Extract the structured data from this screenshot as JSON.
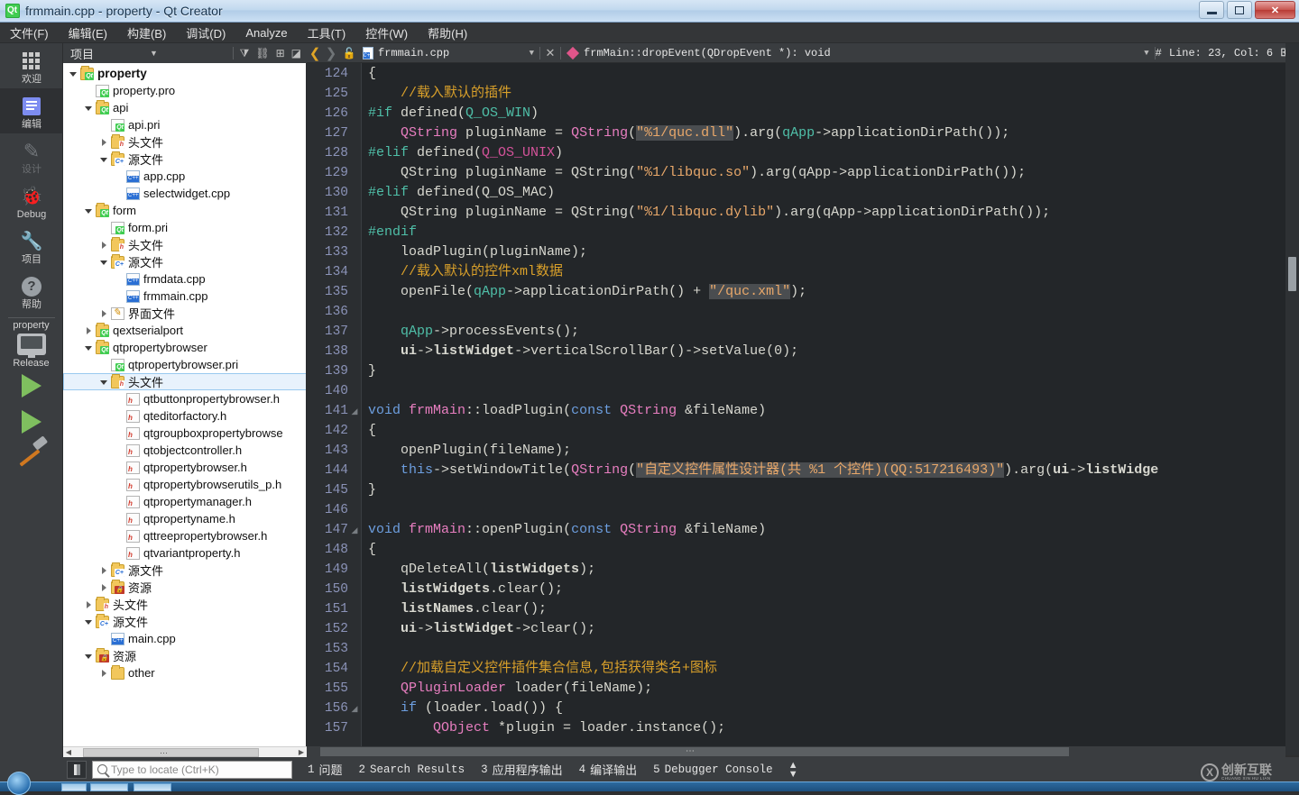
{
  "window": {
    "title": "frmmain.cpp - property - Qt Creator",
    "app_icon": "qt-logo-icon",
    "buttons": {
      "minimize": "minimize-button",
      "maximize": "maximize-button",
      "close": "✕"
    }
  },
  "menubar": {
    "items": [
      {
        "label": "文件(F)",
        "name": "menu-file"
      },
      {
        "label": "编辑(E)",
        "name": "menu-edit"
      },
      {
        "label": "构建(B)",
        "name": "menu-build"
      },
      {
        "label": "调试(D)",
        "name": "menu-debug"
      },
      {
        "label": "Analyze",
        "name": "menu-analyze"
      },
      {
        "label": "工具(T)",
        "name": "menu-tools"
      },
      {
        "label": "控件(W)",
        "name": "menu-window"
      },
      {
        "label": "帮助(H)",
        "name": "menu-help"
      }
    ]
  },
  "mode_rail": {
    "modes": [
      {
        "label": "欢迎",
        "icon": "grid-icon",
        "state": "normal"
      },
      {
        "label": "编辑",
        "icon": "document-lines-icon",
        "state": "active"
      },
      {
        "label": "设计",
        "icon": "pencil-icon",
        "state": "disabled"
      },
      {
        "label": "Debug",
        "icon": "bug-icon",
        "state": "normal"
      },
      {
        "label": "项目",
        "icon": "wrench-icon",
        "state": "normal"
      },
      {
        "label": "帮助",
        "icon": "question-mark-icon",
        "state": "normal"
      }
    ],
    "kit": {
      "project_name": "property",
      "build_config": "Release",
      "icon": "monitor-icon"
    },
    "actions": [
      {
        "name": "run-button",
        "icon": "green-play-icon"
      },
      {
        "name": "debug-button",
        "icon": "play-bug-icon"
      },
      {
        "name": "build-button",
        "icon": "hammer-icon"
      }
    ]
  },
  "tree_panel": {
    "header": {
      "title": "项目",
      "dropdown_icon": "chevron-down-icon",
      "tools": [
        "filter-icon",
        "link-icon",
        "split-add-icon",
        "close-panel-icon"
      ]
    },
    "rows": [
      {
        "depth": 0,
        "arrow": "open",
        "icon": "folder-qt",
        "label": "property",
        "root": true
      },
      {
        "depth": 1,
        "arrow": "none",
        "icon": "doc-qt",
        "label": "property.pro"
      },
      {
        "depth": 1,
        "arrow": "open",
        "icon": "folder-qt",
        "label": "api"
      },
      {
        "depth": 2,
        "arrow": "none",
        "icon": "doc-qt",
        "label": "api.pri"
      },
      {
        "depth": 2,
        "arrow": "closed",
        "icon": "folder-h",
        "label": "头文件"
      },
      {
        "depth": 2,
        "arrow": "open",
        "icon": "folder-cpp",
        "label": "源文件"
      },
      {
        "depth": 3,
        "arrow": "none",
        "icon": "doc-cpp",
        "label": "app.cpp"
      },
      {
        "depth": 3,
        "arrow": "none",
        "icon": "doc-cpp",
        "label": "selectwidget.cpp"
      },
      {
        "depth": 1,
        "arrow": "open",
        "icon": "folder-qt",
        "label": "form"
      },
      {
        "depth": 2,
        "arrow": "none",
        "icon": "doc-qt",
        "label": "form.pri"
      },
      {
        "depth": 2,
        "arrow": "closed",
        "icon": "folder-h",
        "label": "头文件"
      },
      {
        "depth": 2,
        "arrow": "open",
        "icon": "folder-cpp",
        "label": "源文件"
      },
      {
        "depth": 3,
        "arrow": "none",
        "icon": "doc-cpp",
        "label": "frmdata.cpp"
      },
      {
        "depth": 3,
        "arrow": "none",
        "icon": "doc-cpp",
        "label": "frmmain.cpp"
      },
      {
        "depth": 2,
        "arrow": "closed",
        "icon": "folder-ui",
        "label": "界面文件"
      },
      {
        "depth": 1,
        "arrow": "closed",
        "icon": "folder-qt",
        "label": "qextserialport"
      },
      {
        "depth": 1,
        "arrow": "open",
        "icon": "folder-qt",
        "label": "qtpropertybrowser"
      },
      {
        "depth": 2,
        "arrow": "none",
        "icon": "doc-qt",
        "label": "qtpropertybrowser.pri"
      },
      {
        "depth": 2,
        "arrow": "open",
        "icon": "folder-h",
        "label": "头文件",
        "selected": true
      },
      {
        "depth": 3,
        "arrow": "none",
        "icon": "doc-h",
        "label": "qtbuttonpropertybrowser.h"
      },
      {
        "depth": 3,
        "arrow": "none",
        "icon": "doc-h",
        "label": "qteditorfactory.h"
      },
      {
        "depth": 3,
        "arrow": "none",
        "icon": "doc-h",
        "label": "qtgroupboxpropertybrowse"
      },
      {
        "depth": 3,
        "arrow": "none",
        "icon": "doc-h",
        "label": "qtobjectcontroller.h"
      },
      {
        "depth": 3,
        "arrow": "none",
        "icon": "doc-h",
        "label": "qtpropertybrowser.h"
      },
      {
        "depth": 3,
        "arrow": "none",
        "icon": "doc-h",
        "label": "qtpropertybrowserutils_p.h"
      },
      {
        "depth": 3,
        "arrow": "none",
        "icon": "doc-h",
        "label": "qtpropertymanager.h"
      },
      {
        "depth": 3,
        "arrow": "none",
        "icon": "doc-h",
        "label": "qtpropertyname.h"
      },
      {
        "depth": 3,
        "arrow": "none",
        "icon": "doc-h",
        "label": "qttreepropertybrowser.h"
      },
      {
        "depth": 3,
        "arrow": "none",
        "icon": "doc-h",
        "label": "qtvariantproperty.h"
      },
      {
        "depth": 2,
        "arrow": "closed",
        "icon": "folder-cpp",
        "label": "源文件"
      },
      {
        "depth": 2,
        "arrow": "closed",
        "icon": "folder-res",
        "label": "资源"
      },
      {
        "depth": 1,
        "arrow": "closed",
        "icon": "folder-h",
        "label": "头文件"
      },
      {
        "depth": 1,
        "arrow": "open",
        "icon": "folder-cpp",
        "label": "源文件"
      },
      {
        "depth": 2,
        "arrow": "none",
        "icon": "doc-cpp",
        "label": "main.cpp"
      },
      {
        "depth": 1,
        "arrow": "open",
        "icon": "folder-res",
        "label": "资源"
      },
      {
        "depth": 2,
        "arrow": "closed",
        "icon": "folder-plain",
        "label": "other"
      }
    ]
  },
  "editor_bar": {
    "back_icon": "back-arrow-icon",
    "forward_icon": "forward-arrow-icon",
    "lock_icon": "unlocked-padlock-icon",
    "file_name": "frmmain.cpp",
    "file_dropdown_icon": "chevron-down-icon",
    "close_icon": "✕",
    "symbol": "frmMain::dropEvent(QDropEvent *): void",
    "symbol_icon": "method-diamond-icon",
    "symbol_dropdown_icon": "chevron-down-icon",
    "line_col": "Line: 23, Col: 6",
    "hash": "#",
    "split_icon": "split-editor-icon"
  },
  "code": {
    "first_line": 124,
    "lines": [
      {
        "n": 124,
        "fold": false,
        "tokens": [
          {
            "t": "{",
            "c": "fn"
          }
        ]
      },
      {
        "n": 125,
        "fold": false,
        "tokens": [
          {
            "t": "    ",
            "c": "fn"
          },
          {
            "t": "//载入默认的插件",
            "c": "cmt"
          }
        ]
      },
      {
        "n": 126,
        "fold": false,
        "tokens": [
          {
            "t": "#if",
            "c": "prep"
          },
          {
            "t": " defined(",
            "c": "fn"
          },
          {
            "t": "Q_OS_WIN",
            "c": "var"
          },
          {
            "t": ")",
            "c": "fn"
          }
        ]
      },
      {
        "n": 127,
        "fold": false,
        "tokens": [
          {
            "t": "    ",
            "c": "fn"
          },
          {
            "t": "QString",
            "c": "type"
          },
          {
            "t": " pluginName = ",
            "c": "fn"
          },
          {
            "t": "QString",
            "c": "type"
          },
          {
            "t": "(",
            "c": "fn"
          },
          {
            "t": "\"%1/quc.dll\"",
            "c": "str hl"
          },
          {
            "t": ").arg(",
            "c": "fn"
          },
          {
            "t": "qApp",
            "c": "var"
          },
          {
            "t": "->applicationDirPath());",
            "c": "fn"
          }
        ]
      },
      {
        "n": 128,
        "fold": false,
        "tokens": [
          {
            "t": "#elif",
            "c": "prep"
          },
          {
            "t": " defined(",
            "c": "fn"
          },
          {
            "t": "Q_OS_UNIX",
            "c": "macro"
          },
          {
            "t": ")",
            "c": "fn"
          }
        ]
      },
      {
        "n": 129,
        "fold": false,
        "tokens": [
          {
            "t": "    QString pluginName = QString(",
            "c": "fn"
          },
          {
            "t": "\"%1/libquc.so\"",
            "c": "str"
          },
          {
            "t": ").arg(qApp->applicationDirPath());",
            "c": "fn"
          }
        ]
      },
      {
        "n": 130,
        "fold": false,
        "tokens": [
          {
            "t": "#elif",
            "c": "prep"
          },
          {
            "t": " defined(",
            "c": "fn"
          },
          {
            "t": "Q_OS_MAC",
            "c": "fn"
          },
          {
            "t": ")",
            "c": "fn"
          }
        ]
      },
      {
        "n": 131,
        "fold": false,
        "tokens": [
          {
            "t": "    QString pluginName = QString(",
            "c": "fn"
          },
          {
            "t": "\"%1/libquc.dylib\"",
            "c": "str"
          },
          {
            "t": ").arg(qApp->applicationDirPath());",
            "c": "fn"
          }
        ]
      },
      {
        "n": 132,
        "fold": false,
        "tokens": [
          {
            "t": "#endif",
            "c": "prep"
          }
        ]
      },
      {
        "n": 133,
        "fold": false,
        "tokens": [
          {
            "t": "    loadPlugin(pluginName);",
            "c": "fn"
          }
        ]
      },
      {
        "n": 134,
        "fold": false,
        "tokens": [
          {
            "t": "    ",
            "c": "fn"
          },
          {
            "t": "//载入默认的控件xml数据",
            "c": "cmt"
          }
        ]
      },
      {
        "n": 135,
        "fold": false,
        "tokens": [
          {
            "t": "    openFile(",
            "c": "fn"
          },
          {
            "t": "qApp",
            "c": "var"
          },
          {
            "t": "->applicationDirPath() + ",
            "c": "fn"
          },
          {
            "t": "\"/quc.xml\"",
            "c": "str hl"
          },
          {
            "t": ");",
            "c": "fn"
          }
        ]
      },
      {
        "n": 136,
        "fold": false,
        "tokens": []
      },
      {
        "n": 137,
        "fold": false,
        "tokens": [
          {
            "t": "    ",
            "c": "fn"
          },
          {
            "t": "qApp",
            "c": "var"
          },
          {
            "t": "->processEvents();",
            "c": "fn"
          }
        ]
      },
      {
        "n": 138,
        "fold": false,
        "tokens": [
          {
            "t": "    ",
            "c": "fn"
          },
          {
            "t": "ui",
            "c": "bld"
          },
          {
            "t": "->",
            "c": "fn"
          },
          {
            "t": "listWidget",
            "c": "bld"
          },
          {
            "t": "->verticalScrollBar()->setValue(0);",
            "c": "fn"
          }
        ]
      },
      {
        "n": 139,
        "fold": false,
        "tokens": [
          {
            "t": "}",
            "c": "fn"
          }
        ]
      },
      {
        "n": 140,
        "fold": false,
        "tokens": []
      },
      {
        "n": 141,
        "fold": true,
        "tokens": [
          {
            "t": "void",
            "c": "kw"
          },
          {
            "t": " ",
            "c": "fn"
          },
          {
            "t": "frmMain",
            "c": "type"
          },
          {
            "t": "::loadPlugin(",
            "c": "fn"
          },
          {
            "t": "const",
            "c": "kw"
          },
          {
            "t": " ",
            "c": "fn"
          },
          {
            "t": "QString",
            "c": "type"
          },
          {
            "t": " &fileName)",
            "c": "fn"
          }
        ]
      },
      {
        "n": 142,
        "fold": false,
        "tokens": [
          {
            "t": "{",
            "c": "fn"
          }
        ]
      },
      {
        "n": 143,
        "fold": false,
        "tokens": [
          {
            "t": "    openPlugin(fileName);",
            "c": "fn"
          }
        ]
      },
      {
        "n": 144,
        "fold": false,
        "tokens": [
          {
            "t": "    ",
            "c": "fn"
          },
          {
            "t": "this",
            "c": "kw"
          },
          {
            "t": "->setWindowTitle(",
            "c": "fn"
          },
          {
            "t": "QString",
            "c": "type"
          },
          {
            "t": "(",
            "c": "fn"
          },
          {
            "t": "\"自定义控件属性设计器(共 %1 个控件)(QQ:517216493)\"",
            "c": "str hl"
          },
          {
            "t": ").arg(",
            "c": "fn"
          },
          {
            "t": "ui",
            "c": "bld"
          },
          {
            "t": "->",
            "c": "fn"
          },
          {
            "t": "listWidge",
            "c": "bld"
          }
        ]
      },
      {
        "n": 145,
        "fold": false,
        "tokens": [
          {
            "t": "}",
            "c": "fn"
          }
        ]
      },
      {
        "n": 146,
        "fold": false,
        "tokens": []
      },
      {
        "n": 147,
        "fold": true,
        "tokens": [
          {
            "t": "void",
            "c": "kw"
          },
          {
            "t": " ",
            "c": "fn"
          },
          {
            "t": "frmMain",
            "c": "type"
          },
          {
            "t": "::openPlugin(",
            "c": "fn"
          },
          {
            "t": "const",
            "c": "kw"
          },
          {
            "t": " ",
            "c": "fn"
          },
          {
            "t": "QString",
            "c": "type"
          },
          {
            "t": " &fileName)",
            "c": "fn"
          }
        ]
      },
      {
        "n": 148,
        "fold": false,
        "tokens": [
          {
            "t": "{",
            "c": "fn"
          }
        ]
      },
      {
        "n": 149,
        "fold": false,
        "tokens": [
          {
            "t": "    qDeleteAll(",
            "c": "fn"
          },
          {
            "t": "listWidgets",
            "c": "bld"
          },
          {
            "t": ");",
            "c": "fn"
          }
        ]
      },
      {
        "n": 150,
        "fold": false,
        "tokens": [
          {
            "t": "    ",
            "c": "fn"
          },
          {
            "t": "listWidgets",
            "c": "bld"
          },
          {
            "t": ".clear();",
            "c": "fn"
          }
        ]
      },
      {
        "n": 151,
        "fold": false,
        "tokens": [
          {
            "t": "    ",
            "c": "fn"
          },
          {
            "t": "listNames",
            "c": "bld"
          },
          {
            "t": ".clear();",
            "c": "fn"
          }
        ]
      },
      {
        "n": 152,
        "fold": false,
        "tokens": [
          {
            "t": "    ",
            "c": "fn"
          },
          {
            "t": "ui",
            "c": "bld"
          },
          {
            "t": "->",
            "c": "fn"
          },
          {
            "t": "listWidget",
            "c": "bld"
          },
          {
            "t": "->clear();",
            "c": "fn"
          }
        ]
      },
      {
        "n": 153,
        "fold": false,
        "tokens": []
      },
      {
        "n": 154,
        "fold": false,
        "tokens": [
          {
            "t": "    ",
            "c": "fn"
          },
          {
            "t": "//加载自定义控件插件集合信息,包括获得类名+图标",
            "c": "cmt"
          }
        ]
      },
      {
        "n": 155,
        "fold": false,
        "tokens": [
          {
            "t": "    ",
            "c": "fn"
          },
          {
            "t": "QPluginLoader",
            "c": "type"
          },
          {
            "t": " loader(fileName);",
            "c": "fn"
          }
        ]
      },
      {
        "n": 156,
        "fold": true,
        "tokens": [
          {
            "t": "    ",
            "c": "fn"
          },
          {
            "t": "if",
            "c": "kw"
          },
          {
            "t": " (loader.load()) {",
            "c": "fn"
          }
        ]
      },
      {
        "n": 157,
        "fold": false,
        "tokens": [
          {
            "t": "        ",
            "c": "fn"
          },
          {
            "t": "QObject",
            "c": "type"
          },
          {
            "t": " *plugin = loader.instance();",
            "c": "fn"
          }
        ]
      }
    ]
  },
  "statusbar": {
    "sidebar_toggle": "sidebar-toggle-icon",
    "locator_placeholder": "Type to locate (Ctrl+K)",
    "locator_value": "",
    "locator_icon": "magnifier-icon",
    "output_panes": [
      {
        "num": "1",
        "label": "问题",
        "cn": true
      },
      {
        "num": "2",
        "label": "Search Results",
        "cn": false
      },
      {
        "num": "3",
        "label": "应用程序输出",
        "cn": true
      },
      {
        "num": "4",
        "label": "编译输出",
        "cn": true
      },
      {
        "num": "5",
        "label": "Debugger Console",
        "cn": false
      }
    ],
    "updown_icon": "up-down-arrows-icon"
  },
  "watermark": {
    "text": "创新互联",
    "sub": "CHUANG XIN HU LIAN",
    "mark": "X"
  },
  "colors": {
    "accent_blue": "#7d8cf0",
    "editor_bg": "#232629",
    "gutter_bg": "#2b2e31",
    "chrome_bg": "#3a3d40",
    "string": "#e9a86a",
    "comment": "#d9a02a",
    "keyword": "#6d9fe0",
    "type": "#e87ec0",
    "linenum": "#8b93b8"
  }
}
